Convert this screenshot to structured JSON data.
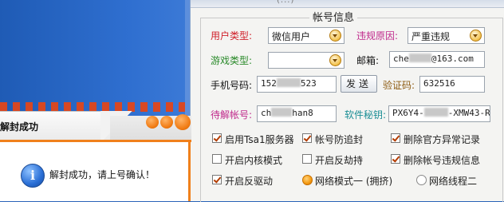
{
  "window": {
    "title_fragment": "(...)"
  },
  "account_info": {
    "group_title": "帐号信息",
    "user_type_label": "用户类型:",
    "user_type_value": "微信用户",
    "violation_reason_label": "违规原因:",
    "violation_reason_value": "严重违规",
    "game_type_label": "游戏类型:",
    "game_type_value": "",
    "email_label": "邮箱:",
    "email_prefix": "che",
    "email_suffix": "@163.com",
    "phone_label": "手机号码:",
    "phone_prefix": "152",
    "phone_suffix": "523",
    "send_button": "发送",
    "verify_code_label": "验证码:",
    "verify_code_value": "632516",
    "unseal_account_label": "待解帐号:",
    "unseal_account_prefix": "ch",
    "unseal_account_suffix": "han8",
    "software_key_label": "软件秘钥:",
    "software_key_prefix": "PX6Y4-",
    "software_key_suffix": "-XMW43-R"
  },
  "options": {
    "checkboxes": [
      {
        "label": "启用Tsa1服务器",
        "checked": true
      },
      {
        "label": "帐号防追封",
        "checked": true
      },
      {
        "label": "删除官方异常记录",
        "checked": true
      },
      {
        "label": "开启内核模式",
        "checked": false
      },
      {
        "label": "开启反劫持",
        "checked": false
      },
      {
        "label": "删除帐号违规信息",
        "checked": true
      },
      {
        "label": "开启反驱动",
        "checked": true
      }
    ],
    "radios": [
      {
        "label": "网络模式一 (拥挤)",
        "selected": true
      },
      {
        "label": "网络线程二",
        "selected": false
      }
    ]
  },
  "dialog": {
    "title": "解封成功",
    "message": "解封成功，请上号确认！",
    "icon": "info-icon"
  },
  "colors": {
    "accent_orange": "#f0801c",
    "background_blue": "#2a63b8",
    "red_label": "#d0202a"
  }
}
